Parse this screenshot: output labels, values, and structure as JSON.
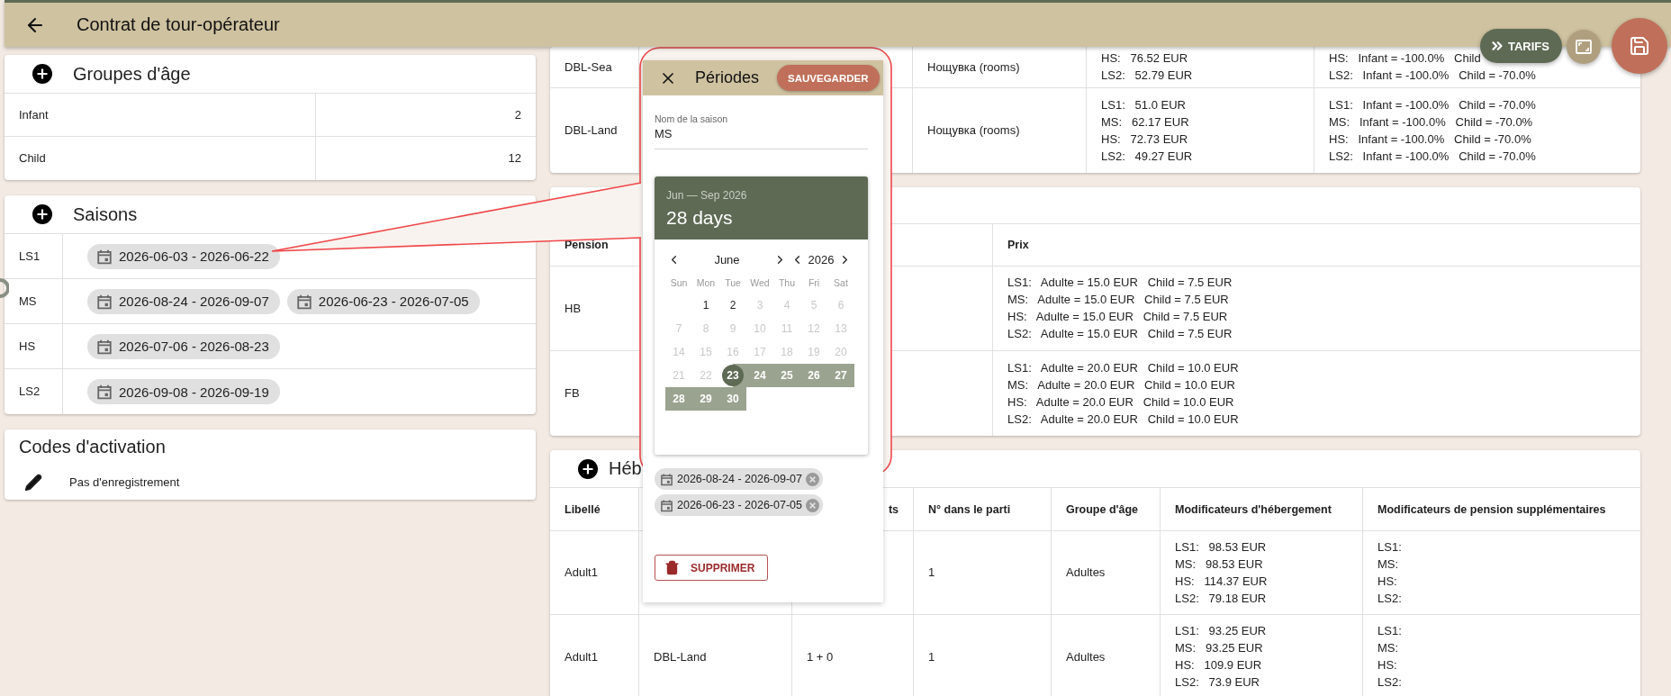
{
  "header": {
    "title": "Contrat de tour-opérateur"
  },
  "actions": {
    "tarifs": "TARIFS"
  },
  "age_groups": {
    "title": "Groupes d'âge",
    "rows": [
      {
        "name": "Infant",
        "value": "2"
      },
      {
        "name": "Child",
        "value": "12"
      }
    ]
  },
  "seasons": {
    "title": "Saisons",
    "rows": [
      {
        "name": "LS1",
        "periods": [
          "2026-06-03 - 2026-06-22"
        ]
      },
      {
        "name": "MS",
        "periods": [
          "2026-08-24 - 2026-09-07",
          "2026-06-23 - 2026-07-05"
        ]
      },
      {
        "name": "HS",
        "periods": [
          "2026-07-06 - 2026-08-23"
        ]
      },
      {
        "name": "LS2",
        "periods": [
          "2026-09-08 - 2026-09-19"
        ]
      }
    ]
  },
  "activation_codes": {
    "title": "Codes d'activation",
    "empty": "Pas d'enregistrement"
  },
  "rooms": {
    "rows": [
      {
        "name": "DBL-Sea",
        "board": "Нощувка (rooms)",
        "prices": [
          "HS:   76.52 EUR",
          "LS2:   52.79 EUR"
        ],
        "modifiers": [
          "HS:   Infant = -100.0%   Child",
          "LS2:   Infant = -100.0%   Child = -70.0%"
        ]
      },
      {
        "name": "DBL-Land",
        "board": "Нощувка (rooms)",
        "prices": [
          "LS1:   51.0 EUR",
          "MS:   62.17 EUR",
          "HS:   72.73 EUR",
          "LS2:   49.27 EUR"
        ],
        "modifiers": [
          "LS1:   Infant = -100.0%   Child = -70.0%",
          "MS:   Infant = -100.0%   Child = -70.0%",
          "HS:   Infant = -100.0%   Child = -70.0%",
          "LS2:   Infant = -100.0%   Child = -70.0%"
        ]
      }
    ]
  },
  "pensions": {
    "columns": [
      "Pension",
      "Prix"
    ],
    "rows": [
      {
        "name": "HB",
        "prices": [
          "LS1:   Adulte = 15.0 EUR   Child = 7.5 EUR",
          "MS:   Adulte = 15.0 EUR   Child = 7.5 EUR",
          "HS:   Adulte = 15.0 EUR   Child = 7.5 EUR",
          "LS2:   Adulte = 15.0 EUR   Child = 7.5 EUR"
        ]
      },
      {
        "name": "FB",
        "prices": [
          "LS1:   Adulte = 20.0 EUR   Child = 10.0 EUR",
          "MS:   Adulte = 20.0 EUR   Child = 10.0 EUR",
          "HS:   Adulte = 20.0 EUR   Child = 10.0 EUR",
          "LS2:   Adulte = 20.0 EUR   Child = 10.0 EUR"
        ]
      }
    ]
  },
  "accommodation": {
    "title": "Héb",
    "columns": [
      "Libellé",
      "ts",
      "N° dans le parti",
      "Groupe d'âge",
      "Modificateurs d'hébergement",
      "Modificateurs de pension supplémentaires"
    ],
    "rows": [
      {
        "label": "Adult1",
        "number": "1",
        "age_group": "Adultes",
        "modifiers": [
          "LS1:   98.53 EUR",
          "MS:   98.53 EUR",
          "HS:   114.37 EUR",
          "LS2:   79.18 EUR"
        ],
        "pension_modifiers": [
          "LS1:",
          "MS:",
          "HS:",
          "LS2:"
        ]
      },
      {
        "label": "Adult1",
        "room": "DBL-Land",
        "occupancy": "1 + 0",
        "number": "1",
        "age_group": "Adultes",
        "modifiers": [
          "LS1:   93.25 EUR",
          "MS:   93.25 EUR",
          "HS:   109.9 EUR",
          "LS2:   73.9 EUR"
        ],
        "pension_modifiers": [
          "LS1:",
          "MS:",
          "HS:",
          "LS2:"
        ]
      }
    ]
  },
  "dialog": {
    "title": "Périodes",
    "save": "SAUVEGARDER",
    "field": {
      "label": "Nom de la saison",
      "value": "MS"
    },
    "calendar": {
      "range": "Jun — Sep 2026",
      "days_count": "28 days",
      "month": "June",
      "year": "2026",
      "weekdays": [
        "Sun",
        "Mon",
        "Tue",
        "Wed",
        "Thu",
        "Fri",
        "Sat"
      ],
      "weeks": [
        [
          {
            "kind": "blank"
          },
          {
            "day": "1",
            "kind": "enabled"
          },
          {
            "day": "2",
            "kind": "enabled"
          },
          {
            "day": "3",
            "kind": "disabled"
          },
          {
            "day": "4",
            "kind": "disabled"
          },
          {
            "day": "5",
            "kind": "disabled"
          },
          {
            "day": "6",
            "kind": "disabled"
          }
        ],
        [
          {
            "day": "7",
            "kind": "disabled"
          },
          {
            "day": "8",
            "kind": "disabled"
          },
          {
            "day": "9",
            "kind": "disabled"
          },
          {
            "day": "10",
            "kind": "disabled"
          },
          {
            "day": "11",
            "kind": "disabled"
          },
          {
            "day": "12",
            "kind": "disabled"
          },
          {
            "day": "13",
            "kind": "disabled"
          }
        ],
        [
          {
            "day": "14",
            "kind": "disabled"
          },
          {
            "day": "15",
            "kind": "disabled"
          },
          {
            "day": "16",
            "kind": "disabled"
          },
          {
            "day": "17",
            "kind": "disabled"
          },
          {
            "day": "18",
            "kind": "disabled"
          },
          {
            "day": "19",
            "kind": "disabled"
          },
          {
            "day": "20",
            "kind": "disabled"
          }
        ],
        [
          {
            "day": "21",
            "kind": "disabled"
          },
          {
            "day": "22",
            "kind": "disabled"
          },
          {
            "day": "23",
            "kind": "start"
          },
          {
            "day": "24",
            "kind": "range"
          },
          {
            "day": "25",
            "kind": "range"
          },
          {
            "day": "26",
            "kind": "range"
          },
          {
            "day": "27",
            "kind": "range"
          }
        ],
        [
          {
            "day": "28",
            "kind": "range"
          },
          {
            "day": "29",
            "kind": "range"
          },
          {
            "day": "30",
            "kind": "range"
          }
        ]
      ]
    },
    "periods": [
      "2026-08-24 - 2026-09-07",
      "2026-06-23 - 2026-07-05"
    ],
    "delete": "SUPPRIMER"
  }
}
